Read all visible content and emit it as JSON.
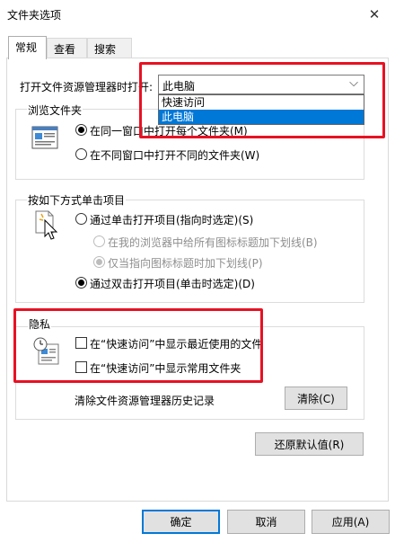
{
  "window": {
    "title": "文件夹选项",
    "close_glyph": "✕"
  },
  "tabs": [
    {
      "label": "常规",
      "active": true
    },
    {
      "label": "查看",
      "active": false
    },
    {
      "label": "搜索",
      "active": false
    }
  ],
  "explorer_open": {
    "label": "打开文件资源管理器时打开:",
    "selected": "此电脑",
    "options": [
      "快速访问",
      "此电脑"
    ]
  },
  "browse_folders": {
    "legend": "浏览文件夹",
    "options": [
      {
        "label": "在同一窗口中打开每个文件夹(M)",
        "checked": true
      },
      {
        "label": "在不同窗口中打开不同的文件夹(W)",
        "checked": false
      }
    ]
  },
  "click_items": {
    "legend": "按如下方式单击项目",
    "options": [
      {
        "label": "通过单击打开项目(指向时选定)(S)",
        "checked": false,
        "enabled": true
      },
      {
        "label": "在我的浏览器中给所有图标标题加下划线(B)",
        "checked": false,
        "enabled": false
      },
      {
        "label": "仅当指向图标标题时加下划线(P)",
        "checked": true,
        "enabled": false
      },
      {
        "label": "通过双击打开项目(单击时选定)(D)",
        "checked": true,
        "enabled": true
      }
    ]
  },
  "privacy": {
    "legend": "隐私",
    "checkboxes": [
      {
        "label": "在“快速访问”中显示最近使用的文件",
        "checked": false
      },
      {
        "label": "在“快速访问”中显示常用文件夹",
        "checked": false
      }
    ],
    "clear_history_label": "清除文件资源管理器历史记录",
    "clear_button": "清除(C)"
  },
  "restore_defaults": "还原默认值(R)",
  "footer": {
    "ok": "确定",
    "cancel": "取消",
    "apply": "应用(A)"
  },
  "colors": {
    "highlight": "#0078d7",
    "annotation_red": "#e81123",
    "dialog_bg": "#f0f0f0"
  }
}
